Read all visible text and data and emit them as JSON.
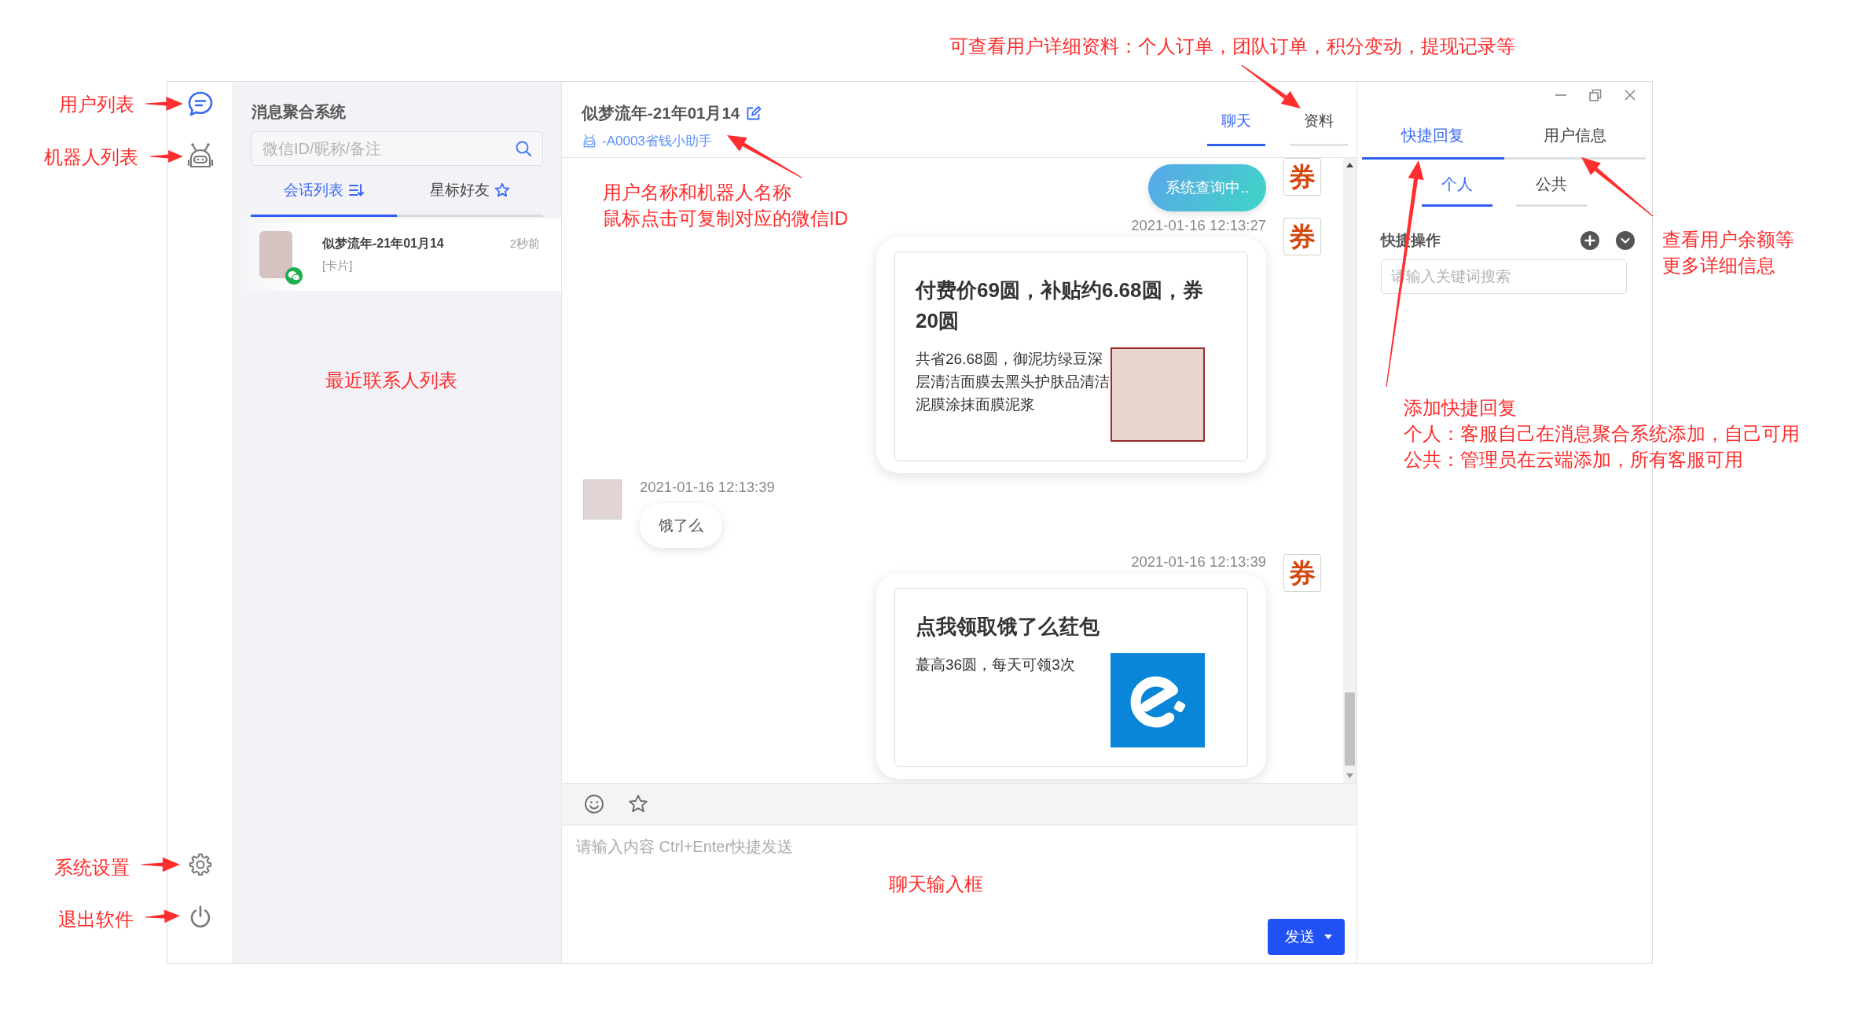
{
  "window": {
    "controls": [
      {
        "kind": "minimize"
      },
      {
        "kind": "restore"
      },
      {
        "kind": "close"
      }
    ]
  },
  "nav_rail": {
    "items": [
      {
        "kind": "chat",
        "selected": true
      },
      {
        "kind": "robot",
        "selected": false
      }
    ],
    "footer_items": [
      {
        "kind": "settings"
      },
      {
        "kind": "power"
      }
    ]
  },
  "contact_panel": {
    "title": "消息聚合系统",
    "search": {
      "placeholder": "微信ID/昵称/备注"
    },
    "tabs": [
      {
        "label": "会话列表",
        "kind": "sort",
        "selected": true
      },
      {
        "label": "星标好友",
        "kind": "star",
        "selected": false
      }
    ],
    "contacts": [
      {
        "name": "似梦流年-21年01月14",
        "time": "2秒前",
        "preview": "[卡片]",
        "badge": true,
        "selected": true
      }
    ]
  },
  "chat": {
    "header": {
      "name": "似梦流年-21年01月14",
      "robot_name": "-A0003省钱小助手"
    },
    "tabs": [
      {
        "label": "聊天",
        "selected": true
      },
      {
        "label": "资料",
        "selected": false
      }
    ],
    "messages": [
      {
        "kind": "status",
        "incoming": false,
        "avatar": "券",
        "text": "系统查询中.."
      },
      {
        "kind": "card",
        "incoming": false,
        "avatar": "券",
        "time": "2021-01-16 12:13:27",
        "title": "付费价69圆，补贴约6.68圆，券20圆",
        "description": "共省26.68圆，御泥坊绿豆深层清洁面膜去黑头护肤品清洁泥膜涂抹面膜泥浆",
        "image": {
          "kind": "photo"
        }
      },
      {
        "kind": "text",
        "incoming": true,
        "time": "2021-01-16 12:13:39",
        "text": "饿了么"
      },
      {
        "kind": "card",
        "incoming": false,
        "avatar": "券",
        "time": "2021-01-16 12:13:39",
        "title": "点我领取饿了么荭包",
        "description": "蕞高36圆，每天可领3次",
        "image": {
          "kind": "logo"
        }
      }
    ],
    "toolbar": [
      {
        "kind": "emoji"
      },
      {
        "kind": "favorite"
      }
    ],
    "input": {
      "placeholder": "请输入内容 Ctrl+Enter快捷发送"
    },
    "send_button": {
      "label": "发送"
    }
  },
  "right_panel": {
    "tabs": [
      {
        "label": "快捷回复",
        "selected": true
      },
      {
        "label": "用户信息",
        "selected": false
      }
    ],
    "subtabs": [
      {
        "label": "个人",
        "selected": true
      },
      {
        "label": "公共",
        "selected": false
      }
    ],
    "quick_actions": {
      "title": "快捷操作",
      "buttons": [
        {
          "kind": "add"
        },
        {
          "kind": "expand"
        }
      ],
      "search": {
        "placeholder": "请输入关键词搜索"
      }
    }
  },
  "annotations": [
    {
      "lines": [
        "可查看用户详细资料：个人订单，团队订单，积分变动，提现记录等"
      ]
    },
    {
      "lines": [
        "用户列表"
      ]
    },
    {
      "lines": [
        "机器人列表"
      ]
    },
    {
      "lines": [
        "用户名称和机器人名称",
        "鼠标点击可复制对应的微信ID"
      ]
    },
    {
      "lines": [
        "查看用户余额等",
        "更多详细信息"
      ]
    },
    {
      "lines": [
        "最近联系人列表"
      ]
    },
    {
      "lines": [
        "添加快捷回复",
        "个人：客服自己在消息聚合系统添加，自己可用",
        "公共：管理员在云端添加，所有客服可用"
      ]
    },
    {
      "lines": [
        "系统设置"
      ]
    },
    {
      "lines": [
        "聊天输入框"
      ]
    },
    {
      "lines": [
        "退出软件"
      ]
    }
  ]
}
